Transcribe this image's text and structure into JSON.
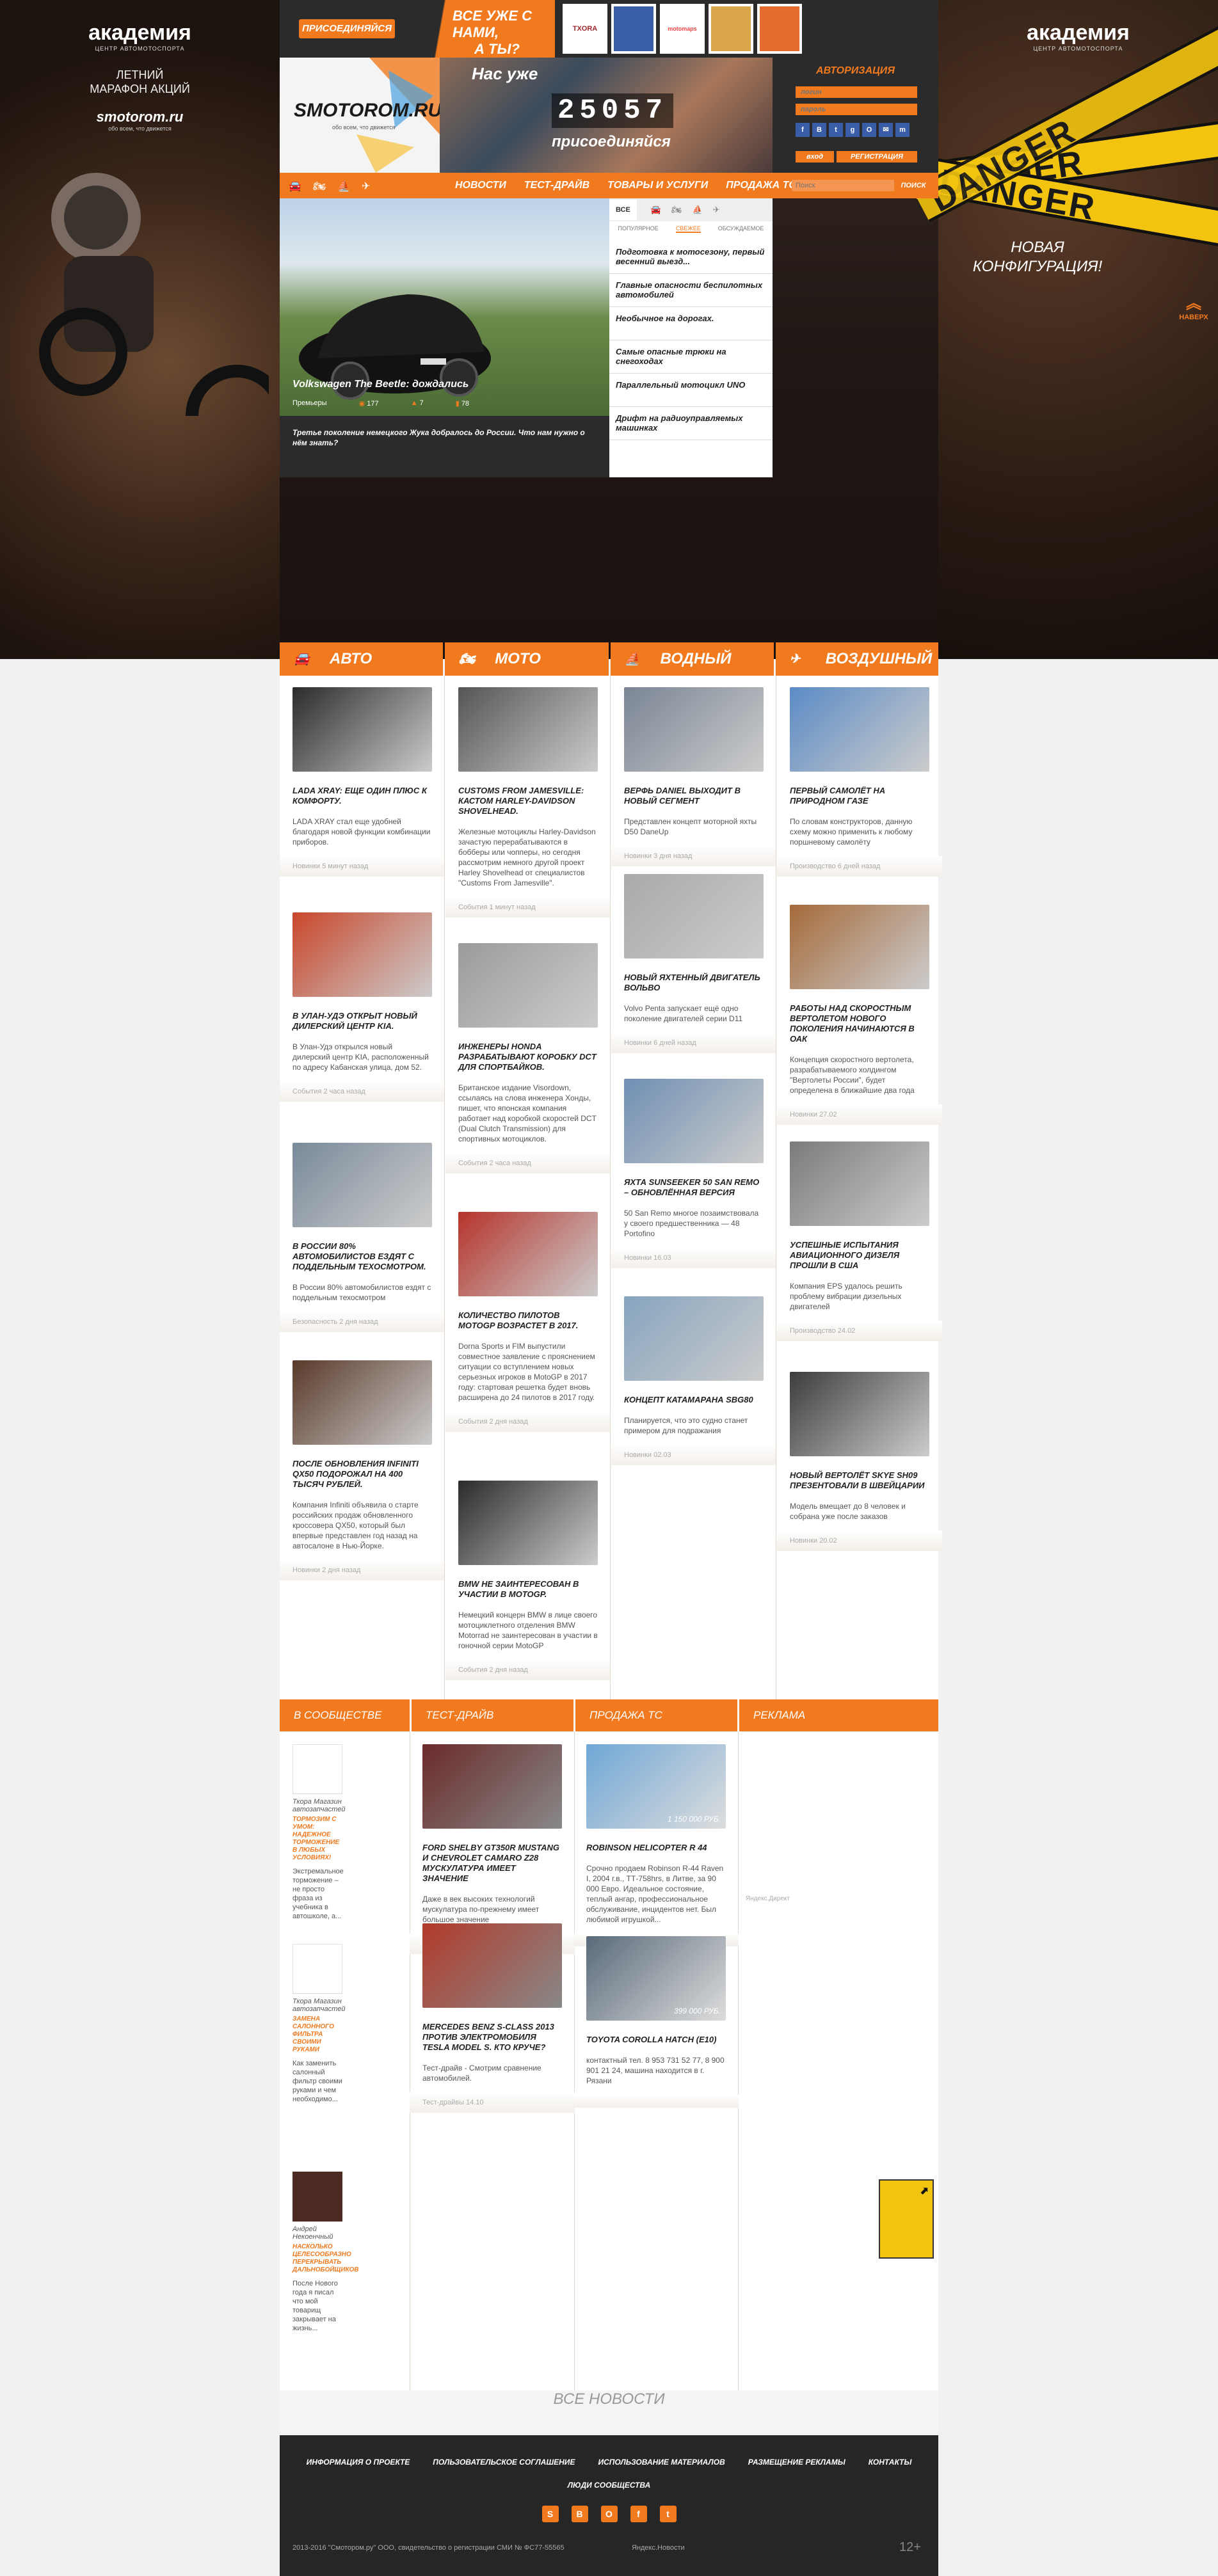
{
  "side_left": {
    "logo": "академия",
    "logo_sub": "ЦЕНТР АВТОМОТОСПОРТА",
    "promo_line1": "ЛЕТНИЙ",
    "promo_line2": "МАРАФОН АКЦИЙ",
    "brand": "smotorom.ru",
    "brand_sub": "обо всем, что движется"
  },
  "side_right": {
    "logo": "академия",
    "logo_sub": "ЦЕНТР АВТОМОТОСПОРТА",
    "tape1": "DANGER",
    "tape2": "DANGER",
    "tape3": "DANGER",
    "promo_line1": "НОВАЯ",
    "promo_line2": "КОНФИГУРАЦИЯ!",
    "totop": "НАВЕРХ"
  },
  "topbar": {
    "join_btn": "ПРИСОЕДИНЯЙСЯ",
    "slogan_line1": "ВСЕ УЖЕ С НАМИ,",
    "slogan_line2": "А ТЫ?",
    "partners": [
      "TXORA",
      "",
      "motomaps",
      "",
      ""
    ]
  },
  "brand": {
    "name": "SMOTOROM.RU",
    "tagline": "обо всем, что движется"
  },
  "counter": {
    "label": "Нас уже",
    "value": "25057",
    "cta": "присоединяйся"
  },
  "auth": {
    "title": "АВТОРИЗАЦИЯ",
    "login_placeholder": "логин",
    "password_placeholder": "пароль",
    "enter": "вход",
    "register": "РЕГИСТРАЦИЯ",
    "social": [
      "f",
      "В",
      "t",
      "g",
      "О",
      "✉",
      "m"
    ]
  },
  "nav": {
    "items": [
      "НОВОСТИ",
      "ТЕСТ-ДРАЙВ",
      "ТОВАРЫ И УСЛУГИ",
      "ПРОДАЖА ТС"
    ],
    "search_placeholder": "Поиск",
    "search_btn": "ПОИСК"
  },
  "hero": {
    "title": "Volkswagen The Beetle: дождались",
    "category": "Премьеры",
    "views": "177",
    "likes": "7",
    "comments": "78",
    "caption": "Третье поколение немецкого Жука добралось до России. Что нам нужно о нём знать?"
  },
  "feed": {
    "tab_all": "ВСЕ",
    "filters": [
      "ПОПУЛЯРНОЕ",
      "СВЕЖЕЕ",
      "ОБСУЖДАЕМОЕ"
    ],
    "items": [
      "Подготовка к мотосезону, первый весенний выезд...",
      "Главные опасности беспилотных автомобилей",
      "Необычное на дорогах.",
      "Самые опасные трюки на снегоходах",
      "Параллельный мотоцикл UNO",
      "Дрифт на радиоуправляемых машинках"
    ]
  },
  "columns": [
    {
      "name": "АВТО",
      "cards": [
        {
          "title": "LADA XRAY: ЕЩЕ ОДИН ПЛЮС К КОМФОРТУ.",
          "desc": "LADA XRAY стал еще удобней благодаря новой функции комбинации приборов.",
          "foot": "Новинки 5 минут назад"
        },
        {
          "title": "В УЛАН-УДЭ ОТКРЫТ НОВЫЙ ДИЛЕРСКИЙ ЦЕНТР KIA.",
          "desc": "В Улан-Удэ открылся новый дилерский центр KIA, расположенный по адресу Кабанская улица, дом 52.",
          "foot": "События 2 часа назад"
        },
        {
          "title": "В РОССИИ 80% АВТОМОБИЛИСТОВ ЕЗДЯТ С ПОДДЕЛЬНЫМ ТЕХОСМОТРОМ.",
          "desc": "В России 80% автомобилистов ездят с поддельным техосмотром",
          "foot": "Безопасность 2 дня назад"
        },
        {
          "title": "ПОСЛЕ ОБНОВЛЕНИЯ INFINITI QX50 ПОДОРОЖАЛ НА 400 ТЫСЯЧ РУБЛЕЙ.",
          "desc": "Компания Infiniti объявила о старте российских продаж обновленного кроссовера QX50, который был впервые представлен год назад на автосалоне в Нью-Йорке.",
          "foot": "Новинки 2 дня назад"
        }
      ]
    },
    {
      "name": "МОТО",
      "cards": [
        {
          "title": "CUSTOMS FROM JAMESVILLE: КАСТОМ HARLEY-DAVIDSON SHOVELHEAD.",
          "desc": "Железные мотоциклы Harley-Davidson зачастую перерабатываются в бобберы или чопперы, но сегодня рассмотрим немного другой проект Harley Shovelhead от специалистов \"Customs From Jamesville\".",
          "foot": "События 1 минут назад"
        },
        {
          "title": "ИНЖЕНЕРЫ HONDA РАЗРАБАТЫВАЮТ КОРОБКУ DCT ДЛЯ СПОРТБАЙКОВ.",
          "desc": "Британское издание Visordown, ссылаясь на слова инженера Хонды, пишет, что японская компания работает над коробкой скоростей DCT (Dual Clutch Transmission) для спортивных мотоциклов.",
          "foot": "События 2 часа назад"
        },
        {
          "title": "КОЛИЧЕСТВО ПИЛОТОВ MOTOGP ВОЗРАСТЕТ В 2017.",
          "desc": "Dorna Sports и FIM выпустили совместное заявление с прояснением ситуации со вступлением новых серьезных игроков в MotoGP в 2017 году: стартовая решетка будет вновь расширена до 24 пилотов в 2017 году.",
          "foot": "События 2 дня назад"
        },
        {
          "title": "BMW НЕ ЗАИНТЕРЕСОВАН В УЧАСТИИ В MOTOGP.",
          "desc": "Немецкий концерн BMW в лице своего мотоциклетного отделения BMW Motorrad не заинтересован в участии в гоночной серии MotoGP",
          "foot": "События 2 дня назад"
        }
      ]
    },
    {
      "name": "ВОДНЫЙ",
      "cards": [
        {
          "title": "ВЕРФЬ DANIEL ВЫХОДИТ В НОВЫЙ СЕГМЕНТ",
          "desc": "Представлен концепт моторной яхты D50 DaneUp",
          "foot": "Новинки 3 дня назад"
        },
        {
          "title": "НОВЫЙ ЯХТЕННЫЙ ДВИГАТЕЛЬ ВОЛЬВО",
          "desc": "Volvo Penta запускает ещё одно поколение двигателей серии D11",
          "foot": "Новинки 6 дней назад"
        },
        {
          "title": "ЯХТА SUNSEEKER 50 SAN REMO – ОБНОВЛЁННАЯ ВЕРСИЯ",
          "desc": "50 San Remo многое позаимствовала у своего предшественника — 48 Portofino",
          "foot": "Новинки 16.03"
        },
        {
          "title": "КОНЦЕПТ КАТАМАРАНА SBG80",
          "desc": "Планируется, что это судно станет примером для подражания",
          "foot": "Новинки 02.03"
        }
      ]
    },
    {
      "name": "ВОЗДУШНЫЙ",
      "cards": [
        {
          "title": "ПЕРВЫЙ САМОЛЁТ НА ПРИРОДНОМ ГАЗЕ",
          "desc": "По словам конструкторов, данную схему можно применить к любому поршневому самолёту",
          "foot": "Производство 6 дней назад"
        },
        {
          "title": "РАБОТЫ НАД СКОРОСТНЫМ ВЕРТОЛЕТОМ НОВОГО ПОКОЛЕНИЯ НАЧИНАЮТСЯ В ОАК",
          "desc": "Концепция скоростного вертолета, разрабатываемого холдингом \"Вертолеты России\", будет определена в ближайшие два года",
          "foot": "Новинки 27.02"
        },
        {
          "title": "УСПЕШНЫЕ ИСПЫТАНИЯ АВИАЦИОННОГО ДИЗЕЛЯ ПРОШЛИ В США",
          "desc": "Компания EPS удалось решить проблему вибрации дизельных двигателей",
          "foot": "Производство 24.02"
        },
        {
          "title": "НОВЫЙ ВЕРТОЛЁТ SKYE SH09 ПРЕЗЕНТОВАЛИ В ШВЕЙЦАРИИ",
          "desc": "Модель вмещает до 8 человек и собрана уже после заказов",
          "foot": "Новинки 20.02"
        }
      ]
    }
  ],
  "community": {
    "head": "В СООБЩЕСТВЕ ПИШУТ",
    "posts": [
      {
        "author": "Ткора Магазин автозапчастей",
        "title": "ТОРМОЗИМ С УМОМ: НАДЕЖНОЕ ТОРМОЖЕНИЕ В ЛЮБЫХ УСЛОВИЯХ!",
        "text": "Экстремальное торможение – не просто фраза из учебника в автошколе, а..."
      },
      {
        "author": "Ткора Магазин автозапчастей",
        "title": "ЗАМЕНА САЛОННОГО ФИЛЬТРА СВОИМИ РУКАМИ",
        "text": "Как заменить салонный фильтр своими руками и чем необходимо..."
      },
      {
        "author": "Андрей Некоенчный",
        "title": "НАСКОЛЬКО ЦЕЛЕСООБРАЗНО ПЕРЕКРЫВАТЬ ДАЛЬНОБОЙЩИКОВ",
        "text": "После Нового года я писал что мой товарищ закрывает на жизнь..."
      }
    ]
  },
  "testdrive": {
    "head": "ТЕСТ-ДРАЙВ",
    "cards": [
      {
        "title": "FORD SHELBY GT350R MUSTANG И CHEVROLET CAMARO Z28 МУСКУЛАТУРА ИМЕЕТ ЗНАЧЕНИЕ",
        "desc": "Даже в век высоких технологий мускулатура по-прежнему имеет большое значение",
        "foot": "Тест-драйвы 06.12"
      },
      {
        "title": "MERCEDES BENZ S-CLASS 2013 ПРОТИВ ЭЛЕКТРОМОБИЛЯ TESLA MODEL S. КТО КРУЧЕ?",
        "desc": "Тест-драйв - Смотрим сравнение автомобилей.",
        "foot": "Тест-драйвы 14.10"
      }
    ]
  },
  "sale": {
    "head": "ПРОДАЖА ТС",
    "cards": [
      {
        "price": "1 150 000 РУБ.",
        "title": "ROBINSON HELICOPTER R 44",
        "desc": "Срочно продаем Robinson R-44 Raven I, 2004 г.в., ТТ-758hrs, в Литве, за 90 000 Евро. Идеальное состояние, теплый ангар, профессиональное обслуживание, инцидентов нет. Был любимой игрушкой..."
      },
      {
        "price": "399 000 РУБ.",
        "title": "TOYOTA COROLLA HATCH (E10)",
        "desc": "контактный тел. 8 953 731 52 77, 8 900 901 21 24, машина находится в г. Рязани"
      }
    ]
  },
  "ads": {
    "head": "РЕКЛАМА",
    "widget": "Яндекс.Директ"
  },
  "all_news": "ВСЕ НОВОСТИ",
  "footer": {
    "links": [
      "ИНФОРМАЦИЯ О ПРОЕКТЕ",
      "ПОЛЬЗОВАТЕЛЬСКОЕ СОГЛАШЕНИЕ",
      "ИСПОЛЬЗОВАНИЕ МАТЕРИАЛОВ",
      "РАЗМЕЩЕНИЕ РЕКЛАМЫ",
      "КОНТАКТЫ"
    ],
    "links2": "ЛЮДИ СООБЩЕСТВА",
    "social": [
      "S",
      "В",
      "О",
      "f",
      "t"
    ],
    "copyright": "2013-2016 \"Смотором.ру\" ООО, свидетельство о регистрации СМИ № ФС77-55565",
    "yandex": "Яндекс.Новости",
    "age": "12+"
  },
  "colors": {
    "accent": "#f17a1f",
    "dark": "#2b2b2b"
  }
}
